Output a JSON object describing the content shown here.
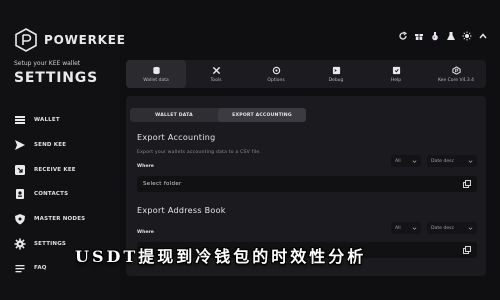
{
  "brand": {
    "name": "POWERKEE"
  },
  "sidebar": {
    "setup_text": "Setup your KEE wallet",
    "title": "SETTINGS",
    "items": [
      {
        "label": "WALLET",
        "icon": "wallet-icon"
      },
      {
        "label": "SEND KEE",
        "icon": "send-icon"
      },
      {
        "label": "RECEIVE KEE",
        "icon": "receive-icon"
      },
      {
        "label": "CONTACTS",
        "icon": "contacts-icon"
      },
      {
        "label": "MASTER NODES",
        "icon": "shield-icon"
      },
      {
        "label": "SETTINGS",
        "icon": "gear-icon"
      },
      {
        "label": "FAQ",
        "icon": "faq-icon"
      }
    ]
  },
  "topbar_icons": [
    "refresh-icon",
    "gift-icon",
    "potion-icon",
    "flask-icon",
    "sun-icon",
    "chevron-up-icon"
  ],
  "tabs": [
    {
      "label": "Wallet data",
      "icon": "database-icon"
    },
    {
      "label": "Tools",
      "icon": "tools-icon"
    },
    {
      "label": "Options",
      "icon": "options-icon"
    },
    {
      "label": "Debug",
      "icon": "debug-icon"
    },
    {
      "label": "Help",
      "icon": "help-icon"
    },
    {
      "label": "Kee Core V4.3.4",
      "icon": "core-icon"
    }
  ],
  "subtabs": [
    {
      "label": "WALLET DATA"
    },
    {
      "label": "EXPORT ACCOUNTING"
    }
  ],
  "export_accounting": {
    "title": "Export Accounting",
    "description": "Export your wallets accounting data to a CSV file.",
    "where_label": "Where",
    "filter": "All",
    "sort": "Date desc",
    "field_value": "Select folder"
  },
  "export_address_book": {
    "title": "Export Address Book",
    "where_label": "Where",
    "filter": "All",
    "sort": "Date desc"
  },
  "overlay_caption": "USDT提现到冷钱包的时效性分析",
  "colors": {
    "background": "#0f0f11",
    "panel": "#1b1b1f",
    "text": "#e9e9ea"
  }
}
